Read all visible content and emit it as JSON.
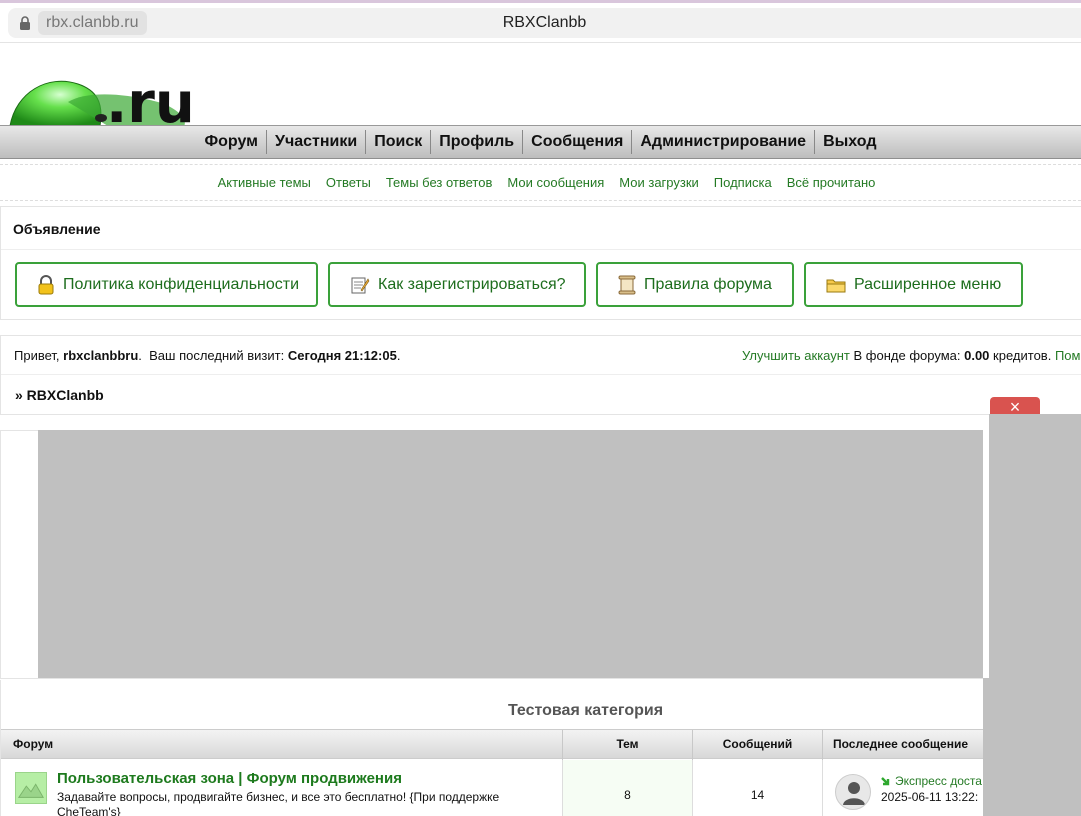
{
  "browser": {
    "url": "rbx.clanbb.ru",
    "tab_title": "RBXClanbb"
  },
  "logo": {
    "text": ".ru"
  },
  "nav": {
    "items": [
      "Форум",
      "Участники",
      "Поиск",
      "Профиль",
      "Сообщения",
      "Администрирование",
      "Выход"
    ]
  },
  "subnav": {
    "items": [
      "Активные темы",
      "Ответы",
      "Темы без ответов",
      "Мои сообщения",
      "Мои загрузки",
      "Подписка",
      "Всё прочитано"
    ]
  },
  "announcement": {
    "title": "Объявление",
    "buttons": [
      {
        "label": "Политика конфиденциальности",
        "icon": "lock-icon"
      },
      {
        "label": "Как зарегистрироваться?",
        "icon": "notepad-icon"
      },
      {
        "label": "Правила форума",
        "icon": "scroll-icon"
      },
      {
        "label": "Расширенное меню",
        "icon": "folder-icon"
      }
    ]
  },
  "welcome": {
    "greeting": "Привет,",
    "username": "rbxclanbbru",
    "last_visit_label": "Ваш последний визит:",
    "last_visit_value": "Сегодня 21:12:05",
    "upgrade_link": "Улучшить аккаунт",
    "fund_label": "В фонде форума:",
    "fund_value": "0.00",
    "fund_unit": "кредитов.",
    "help_link": "Помо",
    "breadcrumb": "» RBXClanbb"
  },
  "ad": {
    "close_icon": "close-icon",
    "close_glyph": "×"
  },
  "category": {
    "title": "Тестовая категория",
    "columns": [
      "Форум",
      "Тем",
      "Сообщений",
      "Последнее сообщение"
    ],
    "rows": [
      {
        "name": "Пользовательская зона | Форум продвижения",
        "description": "Задавайте вопросы, продвигайте бизнес, и все это бесплатно! {При поддержке CheTeam's}",
        "topics": "8",
        "posts": "14",
        "last_post_title": "Экспресс доста",
        "last_post_date": "2025-06-11 13:22:"
      }
    ]
  },
  "colors": {
    "accent": "#247a24",
    "button_border": "#3aa13a",
    "close_red": "#d9534f"
  }
}
